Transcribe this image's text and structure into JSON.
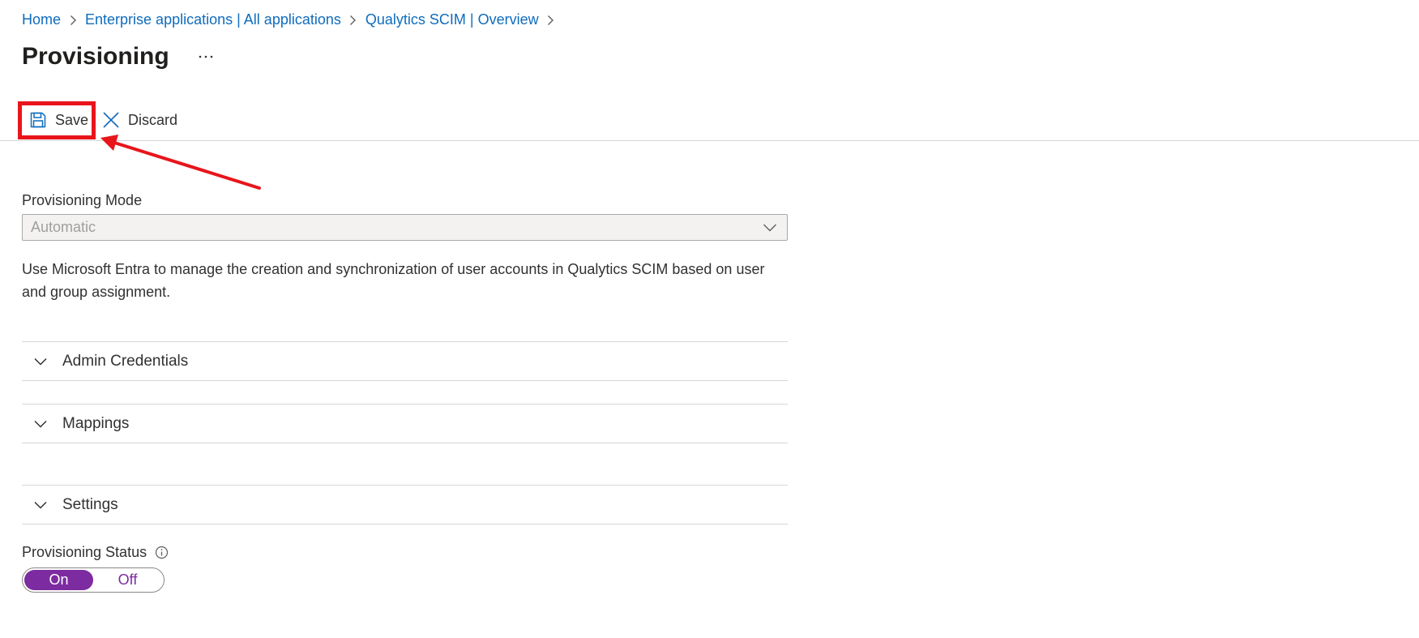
{
  "breadcrumb": {
    "items": [
      "Home",
      "Enterprise applications | All applications",
      "Qualytics SCIM | Overview"
    ]
  },
  "page": {
    "title": "Provisioning",
    "more_label": "···"
  },
  "toolbar": {
    "save_label": "Save",
    "discard_label": "Discard"
  },
  "provisioning_mode": {
    "label": "Provisioning Mode",
    "value": "Automatic"
  },
  "description": "Use Microsoft Entra to manage the creation and synchronization of user accounts in Qualytics SCIM based on user and group assignment.",
  "sections": {
    "admin_credentials": "Admin Credentials",
    "mappings": "Mappings",
    "settings": "Settings"
  },
  "provisioning_status": {
    "label": "Provisioning Status",
    "on_label": "On",
    "off_label": "Off",
    "selected": "On"
  },
  "colors": {
    "link": "#0f6cbd",
    "accent": "#7c2ba0",
    "annotation": "#e8151b"
  },
  "icons": [
    "chevron-right-icon",
    "more-icon",
    "save-icon",
    "close-icon",
    "chevron-down-icon",
    "info-icon"
  ]
}
